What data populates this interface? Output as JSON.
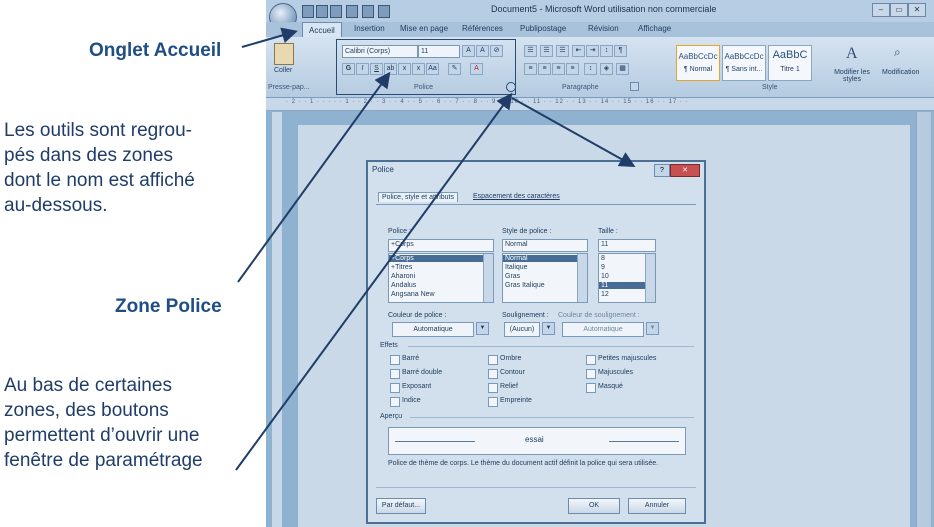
{
  "annotations": {
    "onglet_accueil": "Onglet Accueil",
    "outils_text": [
      "Les outils sont regrou-",
      "pés dans des zones",
      "dont le nom est affiché",
      "au-dessous."
    ],
    "zone_police": "Zone Police",
    "bas_text": [
      "Au bas de certaines",
      "zones, des boutons",
      "permettent d’ouvrir une",
      "fenêtre de paramétrage"
    ]
  },
  "window": {
    "title": "Document5 - Microsoft Word utilisation non commerciale"
  },
  "tabs": [
    "Accueil",
    "Insertion",
    "Mise en page",
    "Références",
    "Publipostage",
    "Révision",
    "Affichage"
  ],
  "ribbon": {
    "paste_label": "Coller",
    "clipboard_group": "Presse-pap...",
    "font_name": "Calibri (Corps)",
    "font_size": "11",
    "font_group": "Police",
    "paragraph_group": "Paragraphe",
    "style_group": "Style",
    "styles": [
      {
        "preview": "AaBbCcDc",
        "name": "¶ Normal"
      },
      {
        "preview": "AaBbCcDc",
        "name": "¶ Sans int..."
      },
      {
        "preview": "AaBbC",
        "name": "Titre 1"
      }
    ],
    "modify_styles": "Modifier les styles",
    "modification": "Modification"
  },
  "dialog": {
    "title": "Police",
    "tab_1": "Police, style et attributs",
    "tab_2": "Espacement des caractères",
    "police_label": "Police :",
    "police_value": "+Corps",
    "police_list": [
      "+Corps",
      "+Titres",
      "Aharoni",
      "Andalus",
      "Angsana New"
    ],
    "style_label": "Style de police :",
    "style_value": "Normal",
    "style_list": [
      "Normal",
      "Italique",
      "Gras",
      "Gras Italique"
    ],
    "taille_label": "Taille :",
    "taille_value": "11",
    "taille_list": [
      "8",
      "9",
      "10",
      "11",
      "12"
    ],
    "couleur_label": "Couleur de police :",
    "couleur_value": "Automatique",
    "soulignement_label": "Soulignement :",
    "soulignement_value": "(Aucun)",
    "couleur_soulignement_label": "Couleur de soulignement :",
    "couleur_soulignement_value": "Automatique",
    "effets_label": "Effets",
    "effets": [
      {
        "label": "Barré"
      },
      {
        "label": "Barré double"
      },
      {
        "label": "Exposant"
      },
      {
        "label": "Indice"
      },
      {
        "label": "Ombre"
      },
      {
        "label": "Contour"
      },
      {
        "label": "Relief"
      },
      {
        "label": "Empreinte"
      },
      {
        "label": "Petites majuscules"
      },
      {
        "label": "Majuscules"
      },
      {
        "label": "Masqué"
      }
    ],
    "apercu_label": "Aperçu",
    "apercu_text": "essai",
    "description": "Police de thème de corps. Le thème du document actif définit la police qui sera utilisée.",
    "default_button": "Par défaut...",
    "ok_button": "OK",
    "cancel_button": "Annuler"
  }
}
